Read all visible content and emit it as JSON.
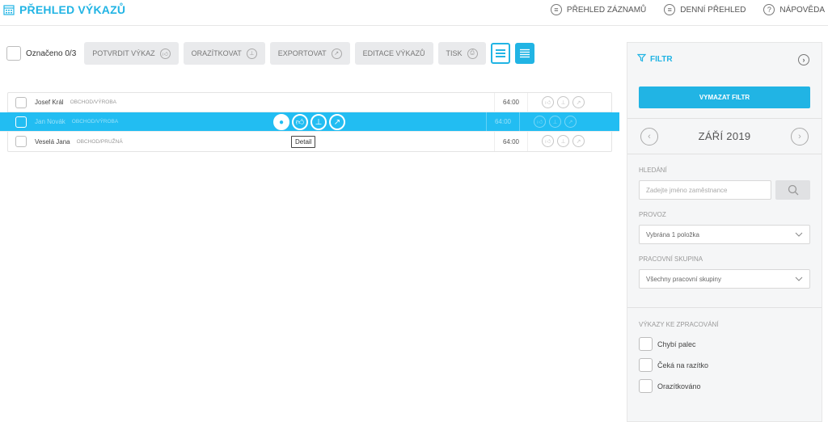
{
  "header": {
    "title": "PŘEHLED VÝKAZŮ",
    "nav": [
      {
        "label": "PŘEHLED ZÁZNAMŮ",
        "icon": "list-icon"
      },
      {
        "label": "DENNÍ PŘEHLED",
        "icon": "list-icon"
      },
      {
        "label": "NÁPOVĚDA",
        "icon": "help-icon"
      }
    ]
  },
  "toolbar": {
    "marked": "Označeno 0/3",
    "buttons": [
      {
        "label": "POTVRDIT VÝKAZ",
        "icon": "thumbs-up-icon"
      },
      {
        "label": "ORAZÍTKOVAT",
        "icon": "stamp-icon"
      },
      {
        "label": "EXPORTOVAT",
        "icon": "export-icon"
      },
      {
        "label": "EDITACE VÝKAZŮ",
        "icon": ""
      },
      {
        "label": "TISK",
        "icon": "print-icon"
      }
    ]
  },
  "table": {
    "rows": [
      {
        "name": "Josef Král",
        "dept": "OBCHOD/VÝROBA",
        "hours": "64:00"
      },
      {
        "name": "Jan Novák",
        "dept": "OBCHOD/VÝROBA",
        "hours": "64:00"
      },
      {
        "name": "Veselá Jana",
        "dept": "OBCHOD/PRUŽNÁ",
        "hours": "64:00"
      }
    ],
    "tooltip": "Detail"
  },
  "sidebar": {
    "title": "FILTR",
    "clear_button": "VYMAZAT FILTR",
    "month": "ZÁŘÍ 2019",
    "search": {
      "label": "HLEDÁNÍ",
      "placeholder": "Zadejte jméno zaměstnance"
    },
    "provoz": {
      "label": "PROVOZ",
      "value": "Vybrána 1 položka"
    },
    "group": {
      "label": "PRACOVNÍ SKUPINA",
      "value": "Všechny pracovní skupiny"
    },
    "processing": {
      "label": "VÝKAZY KE ZPRACOVÁNÍ",
      "options": [
        "Chybí palec",
        "Čeká na razítko",
        "Orazítkováno"
      ]
    }
  },
  "colors": {
    "accent": "#21b4e4",
    "row_highlight": "#22bdf2"
  }
}
